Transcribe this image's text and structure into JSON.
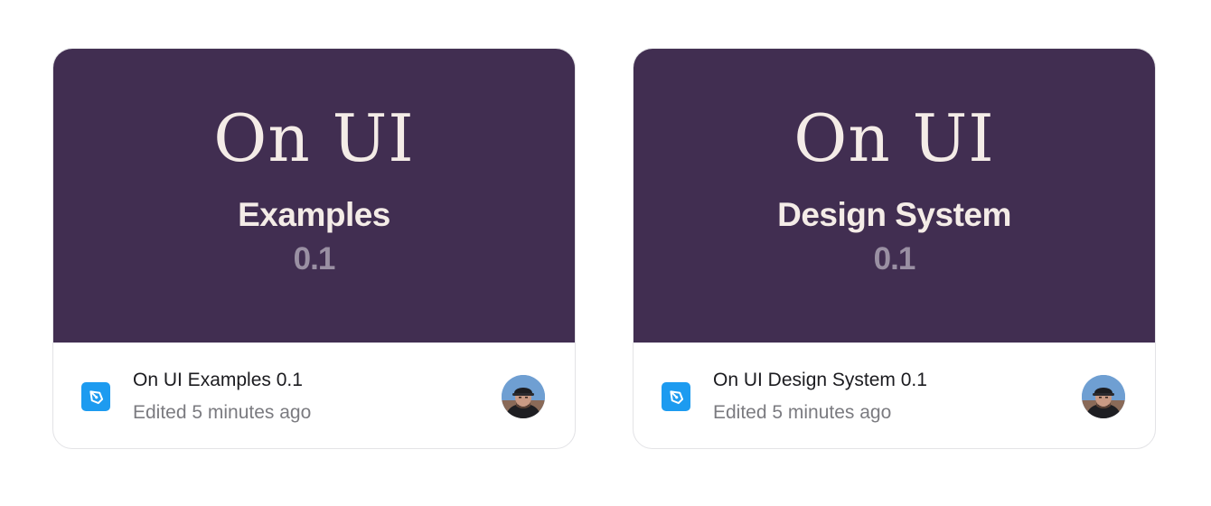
{
  "files": [
    {
      "cover": {
        "logo": "On UI",
        "title": "Examples",
        "version": "0.1"
      },
      "name": "On UI Examples 0.1",
      "edited": "Edited 5 minutes ago",
      "icon": "pen-tool-file-icon",
      "avatar": "user-avatar"
    },
    {
      "cover": {
        "logo": "On UI",
        "title": "Design System",
        "version": "0.1"
      },
      "name": "On UI Design System 0.1",
      "edited": "Edited 5 minutes ago",
      "icon": "pen-tool-file-icon",
      "avatar": "user-avatar"
    }
  ],
  "colors": {
    "cover_bg": "#412e51",
    "cover_text": "#f4ece7",
    "version_text": "#9a90a3",
    "icon_bg": "#1d9bf0"
  }
}
